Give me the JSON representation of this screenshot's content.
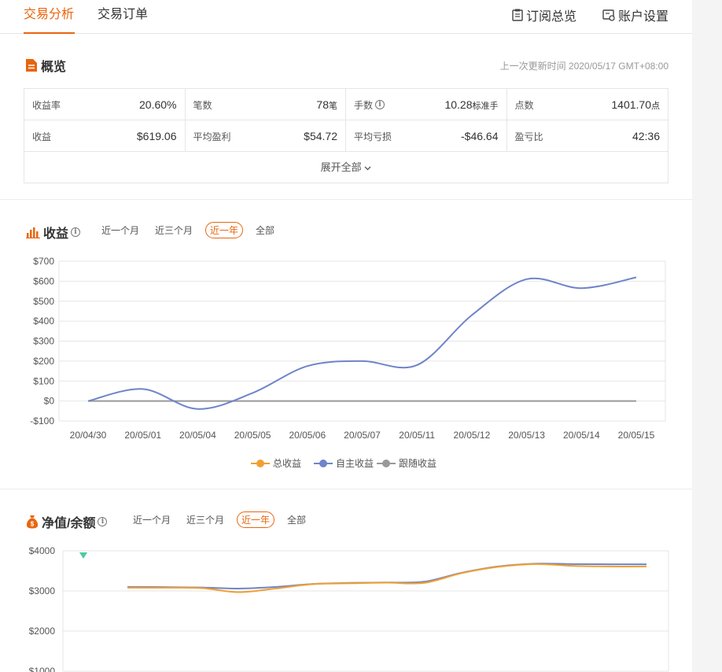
{
  "nav": {
    "tabs": [
      "交易分析",
      "交易订单"
    ],
    "subscribe": "订阅总览",
    "settings": "账户设置"
  },
  "overview": {
    "title": "概览",
    "updated": "上一次更新时间 2020/05/17 GMT+08:00",
    "stats": [
      [
        {
          "label": "收益率",
          "value": "20.60%",
          "unit": ""
        },
        {
          "label": "笔数",
          "value": "78",
          "unit": "笔"
        },
        {
          "label": "手数",
          "value": "10.28",
          "unit": "标准手"
        },
        {
          "label": "点数",
          "value": "1401.70",
          "unit": "点"
        }
      ],
      [
        {
          "label": "收益",
          "value": "$619.06",
          "unit": ""
        },
        {
          "label": "平均盈利",
          "value": "$54.72",
          "unit": ""
        },
        {
          "label": "平均亏损",
          "value": "-$46.64",
          "unit": ""
        },
        {
          "label": "盈亏比",
          "value": "42:36",
          "unit": ""
        }
      ]
    ],
    "expand": "展开全部"
  },
  "profit": {
    "title": "收益",
    "ranges": [
      "近一个月",
      "近三个月",
      "近一年",
      "全部"
    ],
    "active_range": 2
  },
  "equity": {
    "title": "净值/余额",
    "ranges": [
      "近一个月",
      "近三个月",
      "近一年",
      "全部"
    ],
    "active_range": 2
  },
  "colors": {
    "accent": "#e8650f",
    "total": "#f0a030",
    "own": "#6f84c9",
    "follow": "#999999",
    "marker": "#4ecb9e"
  },
  "chart_data": [
    {
      "type": "line",
      "categories": [
        "20/04/30",
        "20/05/01",
        "20/05/04",
        "20/05/05",
        "20/05/06",
        "20/05/07",
        "20/05/11",
        "20/05/12",
        "20/05/13",
        "20/05/14",
        "20/05/15"
      ],
      "ylim": [
        -100,
        700
      ],
      "yticks": [
        -100,
        0,
        100,
        200,
        300,
        400,
        500,
        600,
        700
      ],
      "ytick_labels": [
        "-$100",
        "$0",
        "$100",
        "$200",
        "$300",
        "$400",
        "$500",
        "$600",
        "$700"
      ],
      "legend": [
        "总收益",
        "自主收益",
        "跟随收益"
      ],
      "series": [
        {
          "name": "自主收益",
          "values": [
            0,
            60,
            -40,
            40,
            175,
            200,
            180,
            430,
            610,
            565,
            619.06
          ]
        },
        {
          "name": "跟随收益",
          "values": [
            0,
            0,
            0,
            0,
            0,
            0,
            0,
            0,
            0,
            0,
            0
          ]
        }
      ]
    },
    {
      "type": "line",
      "ylim": [
        1000,
        4000
      ],
      "yticks": [
        1000,
        2000,
        3000,
        4000
      ],
      "ytick_labels": [
        "$1000",
        "$2000",
        "$3000",
        "$4000"
      ],
      "series": [
        {
          "values": [
            3100,
            3095,
            3085,
            3060,
            3100,
            3175,
            3200,
            3210,
            3230,
            3450,
            3610,
            3680,
            3670,
            3665,
            3665
          ]
        },
        {
          "values": [
            3080,
            3080,
            3070,
            2970,
            3060,
            3170,
            3190,
            3205,
            3200,
            3440,
            3600,
            3670,
            3625,
            3610,
            3610
          ]
        }
      ]
    }
  ]
}
